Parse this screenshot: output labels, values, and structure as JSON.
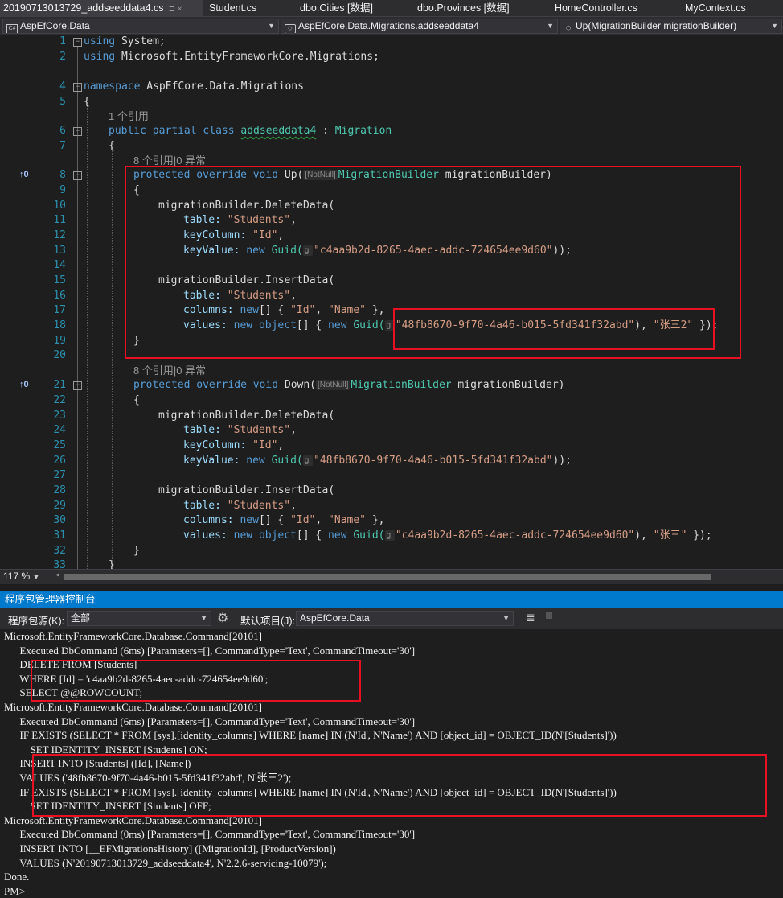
{
  "tabs": [
    {
      "label": "20190713013729_addseeddata4.cs",
      "pin": "⊐ ×"
    },
    {
      "label": "Student.cs"
    },
    {
      "label": "dbo.Cities [数据]"
    },
    {
      "label": "dbo.Provinces [数据]"
    },
    {
      "label": "HomeController.cs"
    },
    {
      "label": "MyContext.cs"
    }
  ],
  "nav": {
    "project": "AspEfCore.Data",
    "type": "AspEfCore.Data.Migrations.addseeddata4",
    "member": "Up(MigrationBuilder migrationBuilder)"
  },
  "editor": {
    "line_numbers": [
      "1",
      "2",
      "3",
      "4",
      "5",
      "6",
      "7",
      "8",
      "9",
      "10",
      "11",
      "12",
      "13",
      "14",
      "15",
      "16",
      "17",
      "18",
      "19",
      "20",
      "21",
      "22",
      "23",
      "24",
      "25",
      "26",
      "27",
      "28",
      "29",
      "30",
      "31",
      "32",
      "33"
    ],
    "lens": {
      "class_refs": "1 个引用",
      "up_refs": "8 个引用|0 异常",
      "down_refs": "8 个引用|0 异常"
    },
    "ref_marker": "↑0",
    "hint_notnull": "[NotNull]",
    "hint_g": "g:",
    "kw": {
      "using": "using",
      "namespace": "namespace",
      "public": "public",
      "partial": "partial",
      "class": "class",
      "protected": "protected",
      "override": "override",
      "void": "void",
      "new": "new",
      "object": "object"
    },
    "text": {
      "system": " System;",
      "migrations_ns": " Microsoft.EntityFrameworkCore.Migrations;",
      "app_ns": " AspEfCore.Data.Migrations",
      "open_brace": "{",
      "close_brace": "}",
      "class_name": "addseeddata4",
      "colon": " : ",
      "base_class": "Migration",
      "up": " Up(",
      "down": " Down(",
      "mb_type": "MigrationBuilder",
      "mb_param": " migrationBuilder)",
      "delete_data": "migrationBuilder.DeleteData(",
      "insert_data": "migrationBuilder.InsertData(",
      "table": "table: ",
      "students": "\"Students\"",
      "comma": ",",
      "key_column": "keyColumn: ",
      "id_str": "\"Id\"",
      "key_value": "keyValue: ",
      "guid": "Guid(",
      "guid1": "\"c4aa9b2d-8265-4aec-addc-724654ee9d60\"",
      "guid2": "\"48fb8670-9f70-4a46-b015-5fd341f32abd\"",
      "close_paren_semi": "));",
      "columns": "columns: ",
      "arr_open": "[] { ",
      "name_str": "\"Name\"",
      "arr_close": " },",
      "values": "values: ",
      "obj_open": "[] { ",
      "zhangsan2": "\"张三2\"",
      "zhangsan": "\"张三\"",
      "close_paren": ")",
      "end_values": " });",
      "sep": ", "
    }
  },
  "zoom": "117 %",
  "package_manager": {
    "title": "程序包管理器控制台",
    "source_label": "程序包源(K):",
    "source_value": "全部",
    "default_project_label": "默认项目(J):",
    "default_project_value": "AspEfCore.Data",
    "lines": [
      "Microsoft.EntityFrameworkCore.Database.Command[20101]",
      "      Executed DbCommand (6ms) [Parameters=[], CommandType='Text', CommandTimeout='30']",
      "      DELETE FROM [Students]",
      "      WHERE [Id] = 'c4aa9b2d-8265-4aec-addc-724654ee9d60';",
      "      SELECT @@ROWCOUNT;",
      "Microsoft.EntityFrameworkCore.Database.Command[20101]",
      "      Executed DbCommand (6ms) [Parameters=[], CommandType='Text', CommandTimeout='30']",
      "      IF EXISTS (SELECT * FROM [sys].[identity_columns] WHERE [name] IN (N'Id', N'Name') AND [object_id] = OBJECT_ID(N'[Students]'))",
      "          SET IDENTITY_INSERT [Students] ON;",
      "      INSERT INTO [Students] ([Id], [Name])",
      "      VALUES ('48fb8670-9f70-4a46-b015-5fd341f32abd', N'张三2');",
      "      IF EXISTS (SELECT * FROM [sys].[identity_columns] WHERE [name] IN (N'Id', N'Name') AND [object_id] = OBJECT_ID(N'[Students]'))",
      "          SET IDENTITY_INSERT [Students] OFF;",
      "Microsoft.EntityFrameworkCore.Database.Command[20101]",
      "      Executed DbCommand (0ms) [Parameters=[], CommandType='Text', CommandTimeout='30']",
      "      INSERT INTO [__EFMigrationsHistory] ([MigrationId], [ProductVersion])",
      "      VALUES (N'20190713013729_addseeddata4', N'2.2.6-servicing-10079');",
      "Done.",
      "PM>"
    ]
  },
  "colors": {
    "accent": "#007acc",
    "highlight_box": "#e81123",
    "keyword": "#569cd6",
    "type": "#4ec9b0",
    "string": "#d69d85"
  }
}
